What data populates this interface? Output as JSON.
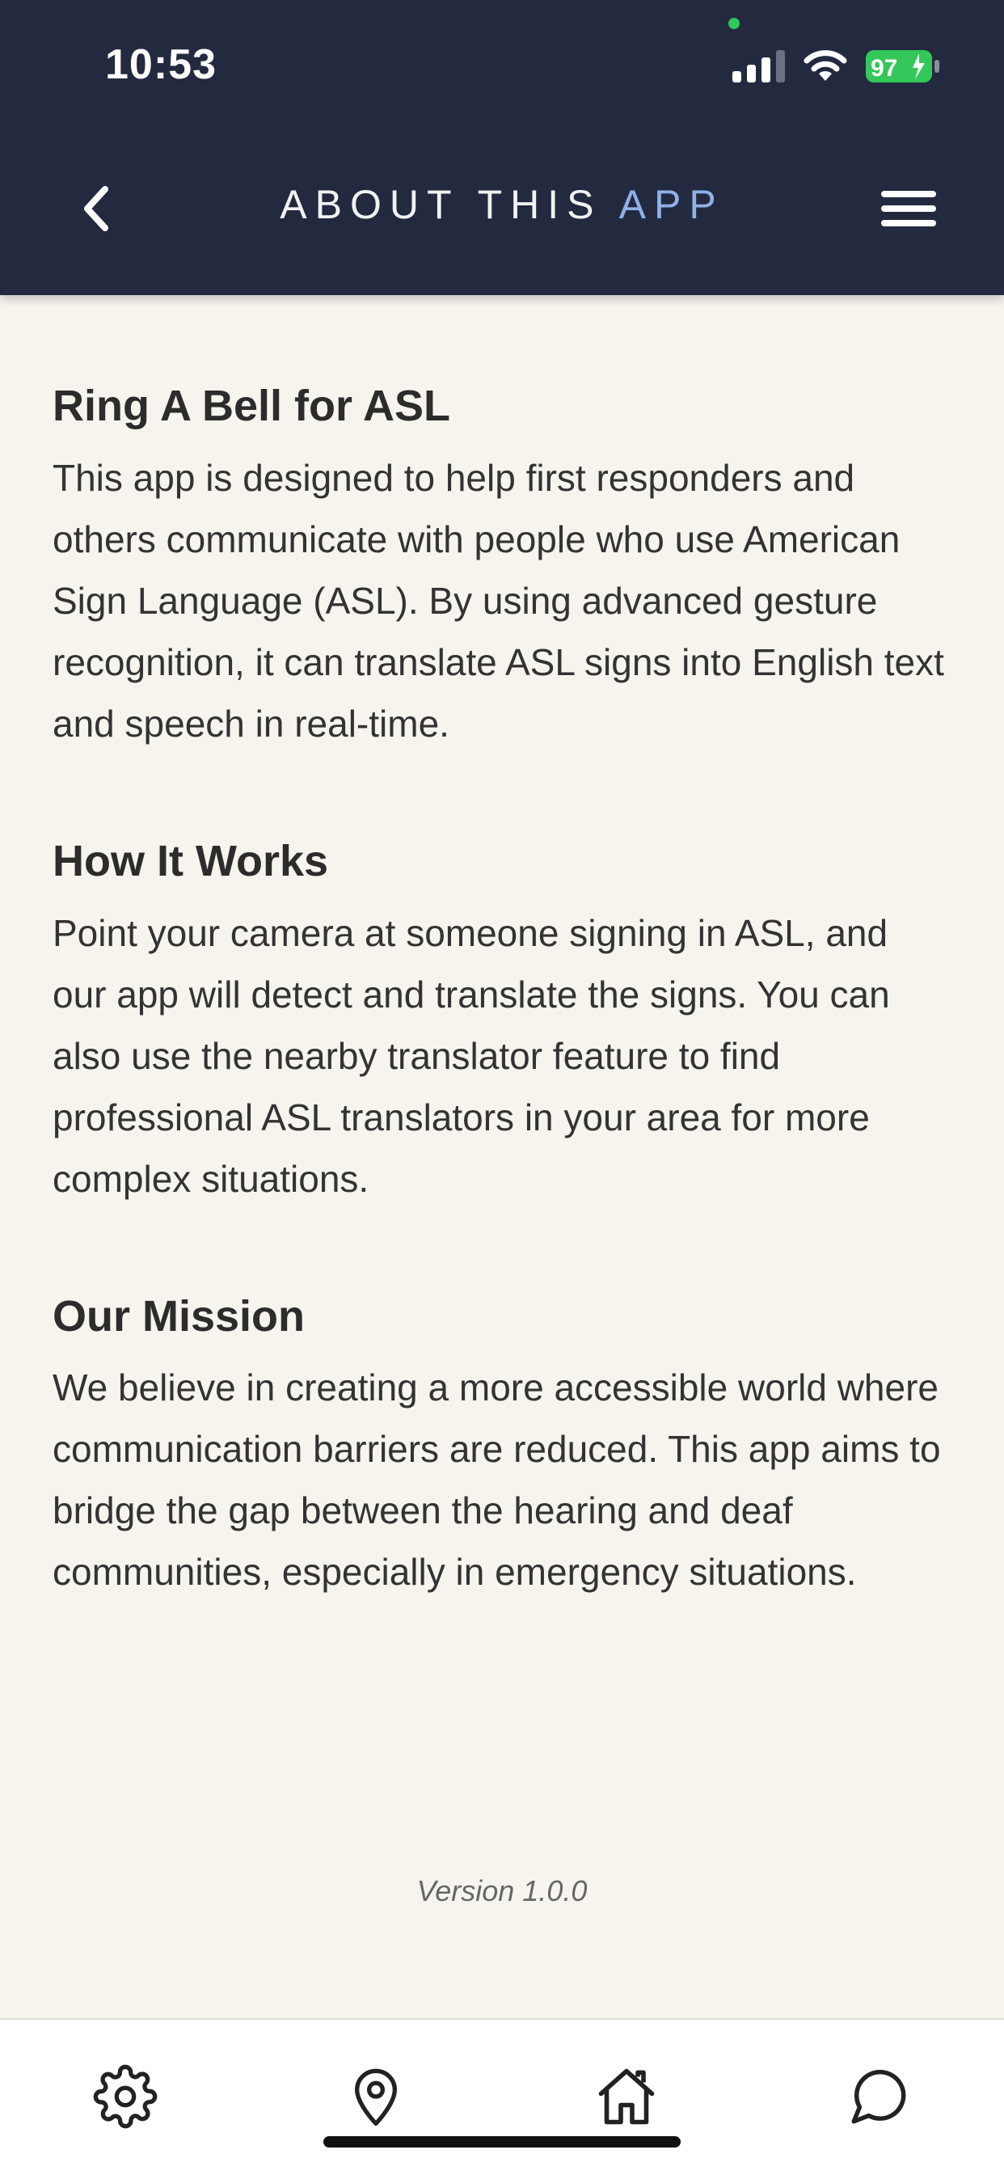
{
  "status_bar": {
    "time": "10:53",
    "battery_level": "97",
    "icons": [
      "cellular-signal-icon",
      "wifi-icon",
      "battery-charging-icon"
    ]
  },
  "header": {
    "title_main": "ABOUT THIS",
    "title_accent": "APP",
    "background_color": "#232a3f",
    "accent_color": "#8fb1e8",
    "icons": [
      "chevron-left-icon",
      "hamburger-menu-icon"
    ]
  },
  "sections": [
    {
      "heading": "Ring A Bell for ASL",
      "body": "This app is designed to help first responders and others communicate with people who use American Sign Language (ASL). By using advanced gesture recognition, it can translate ASL signs into English text and speech in real-time."
    },
    {
      "heading": "How It Works",
      "body": "Point your camera at someone signing in ASL, and our app will detect and translate the signs. You can also use the nearby translator feature to find professional ASL translators in your area for more complex situations."
    },
    {
      "heading": "Our Mission",
      "body": "We believe in creating a more accessible world where communication barriers are reduced. This app aims to bridge the gap between the hearing and deaf communities, especially in emergency situations."
    }
  ],
  "version": "Version 1.0.0",
  "tab_bar": {
    "icons": [
      "gear-icon",
      "location-pin-icon",
      "home-icon",
      "chat-bubble-icon"
    ]
  }
}
